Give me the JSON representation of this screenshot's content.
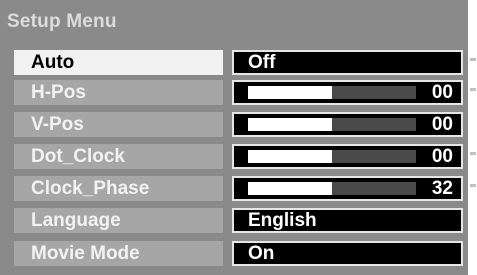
{
  "menu": {
    "title": "Setup Menu",
    "items": [
      {
        "label": "Auto",
        "type": "option",
        "value": "Off",
        "selected": true
      },
      {
        "label": "H-Pos",
        "type": "slider",
        "value": "00",
        "level": 0.5
      },
      {
        "label": "V-Pos",
        "type": "slider",
        "value": "00",
        "level": 0.5
      },
      {
        "label": "Dot_Clock",
        "type": "slider",
        "value": "00",
        "level": 0.5
      },
      {
        "label": "Clock_Phase",
        "type": "slider",
        "value": "32",
        "level": 0.5
      },
      {
        "label": "Language",
        "type": "option",
        "value": "English"
      },
      {
        "label": "Movie Mode",
        "type": "option",
        "value": "On"
      }
    ]
  },
  "colors": {
    "panel": "#8a8a8a",
    "label_bg": "#a6a6a6",
    "selected_label_bg": "#f2f2f2",
    "value_bg": "#000000",
    "slider_fill": "#ffffff",
    "slider_track": "#4a4a4a"
  }
}
